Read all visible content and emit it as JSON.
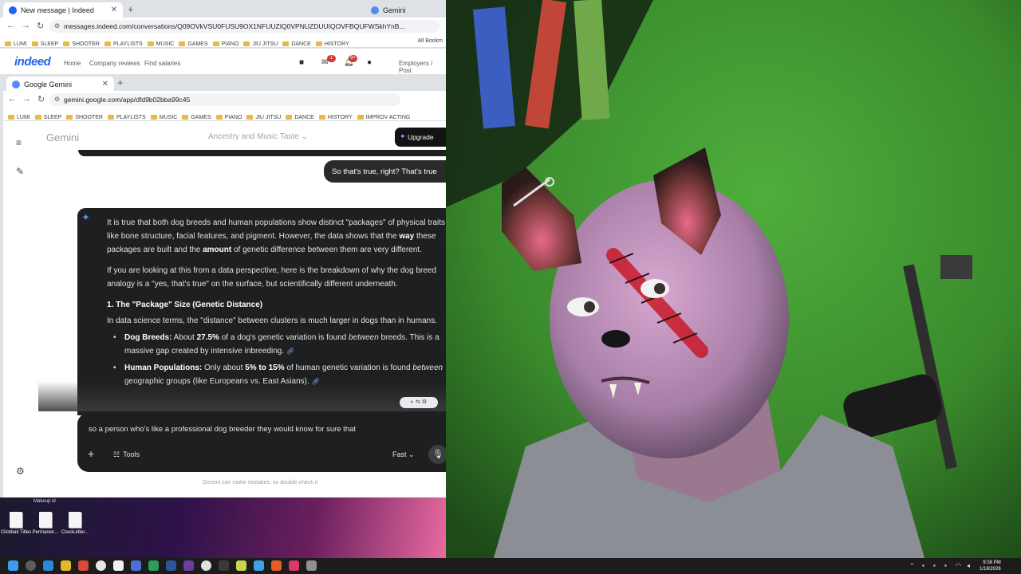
{
  "outer_browser": {
    "tab_title": "New message | Indeed",
    "tab2_title": "Gemini",
    "url": "messages.indeed.com/conversations/Q09OVkVSU0FUSU9OX1NFUUZIQ0VPNUZDUUIQOVFBQUFWSkhYnB...",
    "bookmarks": [
      "LUMI",
      "SLEEP",
      "SHOOTER",
      "PLAYLISTS",
      "MUSIC",
      "GAMES",
      "PIANO",
      "JIU JITSU",
      "DANCE",
      "HISTORY"
    ],
    "all_bookmarks": "All Bookm",
    "indeed": {
      "logo": "indeed",
      "links": [
        "Home",
        "Company reviews",
        "Find salaries"
      ],
      "msg_badge": "1",
      "notif_badge": "9+",
      "employers": "Employers / Post"
    }
  },
  "inner_browser": {
    "tab_title": "Google Gemini",
    "url": "gemini.google.com/app/dfd9b02bba99c45",
    "bookmarks": [
      "LUMI",
      "SLEEP",
      "SHOOTER",
      "PLAYLISTS",
      "MUSIC",
      "GAMES",
      "PIANO",
      "JIU JITSU",
      "DANCE",
      "HISTORY",
      "IMPROV ACTING"
    ]
  },
  "gemini": {
    "brand": "Gemini",
    "conversation_title": "Ancestry and Music Taste",
    "upgrade_label": "Upgrade",
    "user_message": "So that's true, right? That's true",
    "answer": {
      "p1_a": "It is true that both dog breeds and human populations show distinct \"packages\" of physical traits like bone structure, facial features, and pigment. However, the data shows that the ",
      "p1_b1": "way",
      "p1_c": " these packages are built and the ",
      "p1_b2": "amount",
      "p1_d": " of genetic difference between them are very different.",
      "p2": "If you are looking at this from a data perspective, here is the breakdown of why the dog breed analogy is a \"yes, that's true\" on the surface, but scientifically different underneath.",
      "h1": "1. The \"Package\" Size (Genetic Distance)",
      "p3": "In data science terms, the \"distance\" between clusters is much larger in dogs than in humans.",
      "li1_label": "Dog Breeds:",
      "li1_a": " About ",
      "li1_pct": "27.5%",
      "li1_b": " of a dog's genetic variation is found ",
      "li1_em": "between",
      "li1_c": " breeds. This is a massive gap created by intensive inbreeding.",
      "li2_label": "Human Populations:",
      "li2_a": " Only about ",
      "li2_pct": "5% to 15%",
      "li2_b": " of human genetic variation is found ",
      "li2_em": "between",
      "li2_c": " geographic groups (like Europeans vs. East Asians)."
    },
    "input_value": "so a person who's like a professional dog breeder they would know for sure that",
    "tools_label": "Tools",
    "mode_label": "Fast",
    "disclaimer": "Gemini can make mistakes, so double-check it"
  },
  "desktop": {
    "top_label": "Makeup id",
    "files": [
      "Clickbait Titles",
      "Permanen...",
      "CovoLetter..."
    ]
  },
  "taskbar": {
    "time": "9:38 PM",
    "date": "1/18/2026"
  },
  "colors": {
    "indeed_blue": "#2164f3",
    "gemini_dark": "#1e1f20",
    "green_screen": "#3e8a32"
  }
}
